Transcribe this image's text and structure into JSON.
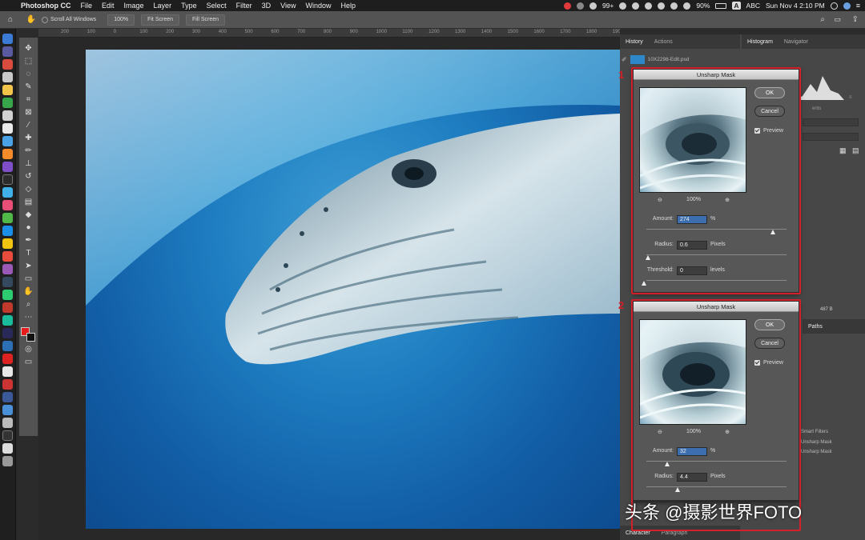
{
  "menubar": {
    "app_name": "Photoshop CC",
    "items": [
      "File",
      "Edit",
      "Image",
      "Layer",
      "Type",
      "Select",
      "Filter",
      "3D",
      "View",
      "Window",
      "Help"
    ],
    "badge": "99+",
    "battery": "90%",
    "input_source": "ABC",
    "datetime": "Sun Nov 4  2:10 PM"
  },
  "options_bar": {
    "scroll_all_windows": "Scroll All Windows",
    "zoom": "100%",
    "fit_screen": "Fit Screen",
    "fill_screen": "Fill Screen"
  },
  "ruler_ticks": [
    "200",
    "100",
    "0",
    "100",
    "200",
    "300",
    "400",
    "500",
    "600",
    "700",
    "800",
    "900",
    "1000",
    "1100",
    "1200",
    "1300",
    "1400",
    "1500",
    "1600",
    "1700",
    "1800",
    "1900",
    "2000",
    "2100",
    "2200",
    "2300",
    "2400",
    "2500",
    "2600",
    "2700",
    "2800",
    "2900",
    "3000",
    "3100",
    "3200",
    "3300"
  ],
  "right_panel": {
    "history_tab": "History",
    "actions_tab": "Actions",
    "histogram_tab": "Histogram",
    "navigator_tab": "Navigator",
    "history_file": "10X2298-Edit.psd",
    "paths_tab": "Paths",
    "smart_filters": "Smart Filters",
    "filter_1": "Unsharp Mask",
    "filter_2": "Unsharp Mask",
    "size_readout": "487 B",
    "character_tab": "Character",
    "paragraph_tab": "Paragraph"
  },
  "dialog1": {
    "title": "Unsharp Mask",
    "ok": "OK",
    "cancel": "Cancel",
    "preview": "Preview",
    "zoom": "100%",
    "amount_label": "Amount:",
    "amount": "274",
    "amount_unit": "%",
    "radius_label": "Radius:",
    "radius": "0.6",
    "radius_unit": "Pixels",
    "threshold_label": "Threshold:",
    "threshold": "0",
    "threshold_unit": "levels",
    "marker": "1"
  },
  "dialog2": {
    "title": "Unsharp Mask",
    "ok": "OK",
    "cancel": "Cancel",
    "preview": "Preview",
    "zoom": "100%",
    "amount_label": "Amount:",
    "amount": "32",
    "amount_unit": "%",
    "radius_label": "Radius:",
    "radius": "4.4",
    "radius_unit": "Pixels",
    "marker": "2"
  },
  "watermark": "头条 @摄影世界FOTO",
  "colors": {
    "accent_red": "#d4202a",
    "foreground": "#e51c1c",
    "background": "#111111"
  }
}
